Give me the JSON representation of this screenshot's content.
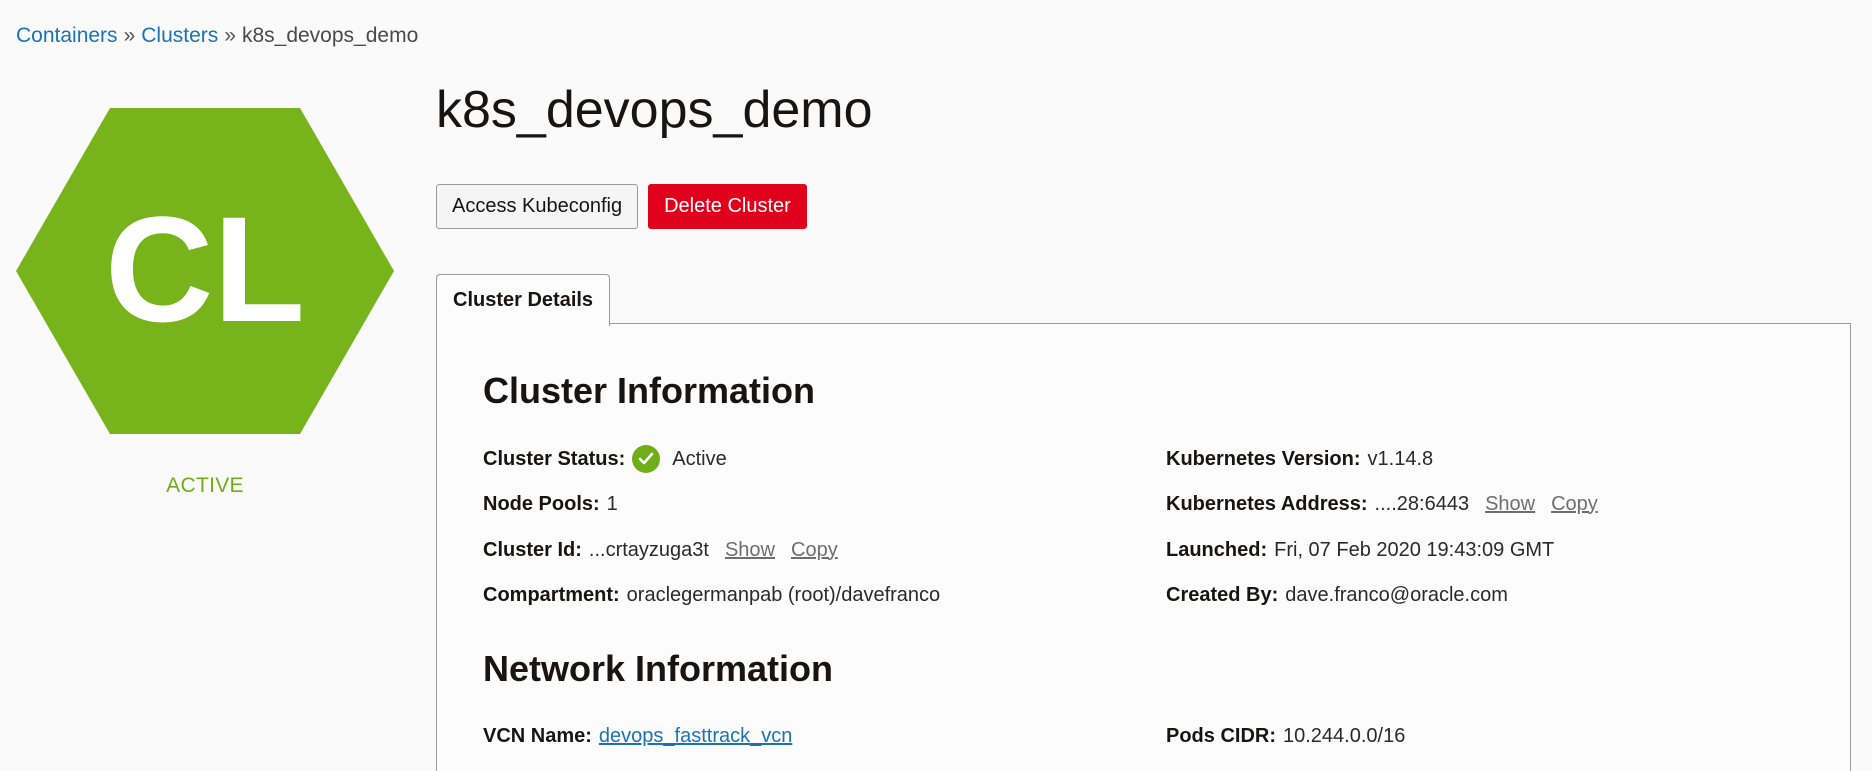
{
  "breadcrumb": {
    "items": [
      "Containers",
      "Clusters"
    ],
    "current": "k8s_devops_demo",
    "separator": "»"
  },
  "logo": {
    "initials": "CL",
    "color": "#77b41b"
  },
  "state_label": "ACTIVE",
  "title": "k8s_devops_demo",
  "actions": {
    "access_kubeconfig": "Access Kubeconfig",
    "delete_cluster": "Delete Cluster"
  },
  "tab": {
    "label": "Cluster Details"
  },
  "cluster_info": {
    "heading": "Cluster Information",
    "status": {
      "label": "Cluster Status:",
      "value": "Active"
    },
    "node_pools": {
      "label": "Node Pools:",
      "value": "1"
    },
    "cluster_id": {
      "label": "Cluster Id:",
      "value": "...crtayzuga3t",
      "show": "Show",
      "copy": "Copy"
    },
    "compartment": {
      "label": "Compartment:",
      "value": "oraclegermanpab (root)/davefranco"
    },
    "k8s_version": {
      "label": "Kubernetes Version:",
      "value": "v1.14.8"
    },
    "k8s_address": {
      "label": "Kubernetes Address:",
      "value": "....28:6443",
      "show": "Show",
      "copy": "Copy"
    },
    "launched": {
      "label": "Launched:",
      "value": "Fri, 07 Feb 2020 19:43:09 GMT"
    },
    "created_by": {
      "label": "Created By:",
      "value": "dave.franco@oracle.com"
    }
  },
  "network_info": {
    "heading": "Network Information",
    "vcn_name": {
      "label": "VCN Name:",
      "value": "devops_fasttrack_vcn"
    },
    "pods_cidr": {
      "label": "Pods CIDR:",
      "value": "10.244.0.0/16"
    }
  },
  "colors": {
    "accent_link": "#1a73b4",
    "active_green": "#6fae19",
    "danger": "#e0001b"
  }
}
